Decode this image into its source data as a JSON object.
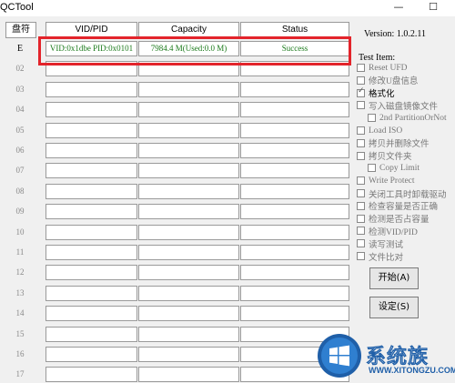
{
  "window": {
    "title": "QCTool",
    "minimize_glyph": "—",
    "maximize_glyph": "☐"
  },
  "table": {
    "headers": {
      "drive": "盘符",
      "vidpid": "VID/PID",
      "capacity": "Capacity",
      "status": "Status"
    },
    "rows": [
      {
        "drive": "E",
        "vidpid": "VID:0x1dbe PID:0x0101",
        "capacity": "7984.4 M(Used:0.0 M)",
        "status": "Success"
      },
      {
        "drive": "02"
      },
      {
        "drive": "03"
      },
      {
        "drive": "04"
      },
      {
        "drive": "05"
      },
      {
        "drive": "06"
      },
      {
        "drive": "07"
      },
      {
        "drive": "08"
      },
      {
        "drive": "09"
      },
      {
        "drive": "10"
      },
      {
        "drive": "11"
      },
      {
        "drive": "12"
      },
      {
        "drive": "13"
      },
      {
        "drive": "14"
      },
      {
        "drive": "15"
      },
      {
        "drive": "16"
      },
      {
        "drive": "17"
      }
    ]
  },
  "panel": {
    "version": "Version: 1.0.2.11",
    "test_item_label": "Test Item:",
    "options": [
      {
        "label": "Reset UFD",
        "checked": false,
        "enabled": false
      },
      {
        "label": "修改U盘信息",
        "checked": false,
        "enabled": false
      },
      {
        "label": "格式化",
        "checked": true,
        "enabled": true
      },
      {
        "label": "写入磁盘镜像文件",
        "checked": false,
        "enabled": false
      },
      {
        "label": "2nd PartitionOrNot",
        "checked": false,
        "enabled": false
      },
      {
        "label": "Load ISO",
        "checked": false,
        "enabled": false
      },
      {
        "label": "拷贝并删除文件",
        "checked": false,
        "enabled": false
      },
      {
        "label": "拷贝文件夹",
        "checked": false,
        "enabled": false
      },
      {
        "label": "Copy Limit",
        "checked": false,
        "enabled": false
      },
      {
        "label": "Write Protect",
        "checked": false,
        "enabled": false
      },
      {
        "label": "关闭工具时卸载驱动",
        "checked": false,
        "enabled": false
      },
      {
        "label": "检查容量是否正确",
        "checked": false,
        "enabled": false
      },
      {
        "label": "检测是否占容量",
        "checked": false,
        "enabled": false
      },
      {
        "label": "检测VID/PID",
        "checked": false,
        "enabled": false
      },
      {
        "label": "读写测试",
        "checked": false,
        "enabled": false
      },
      {
        "label": "文件比对",
        "checked": false,
        "enabled": false
      }
    ],
    "start_button": "开始(A)",
    "settings_button": "设定(S)"
  },
  "watermark": {
    "text": "系统族",
    "url": "WWW.XITONGZU.COM"
  },
  "colors": {
    "status_text": "#1a7a1a",
    "highlight": "#e3242b",
    "watermark": "#1f5fa8"
  }
}
